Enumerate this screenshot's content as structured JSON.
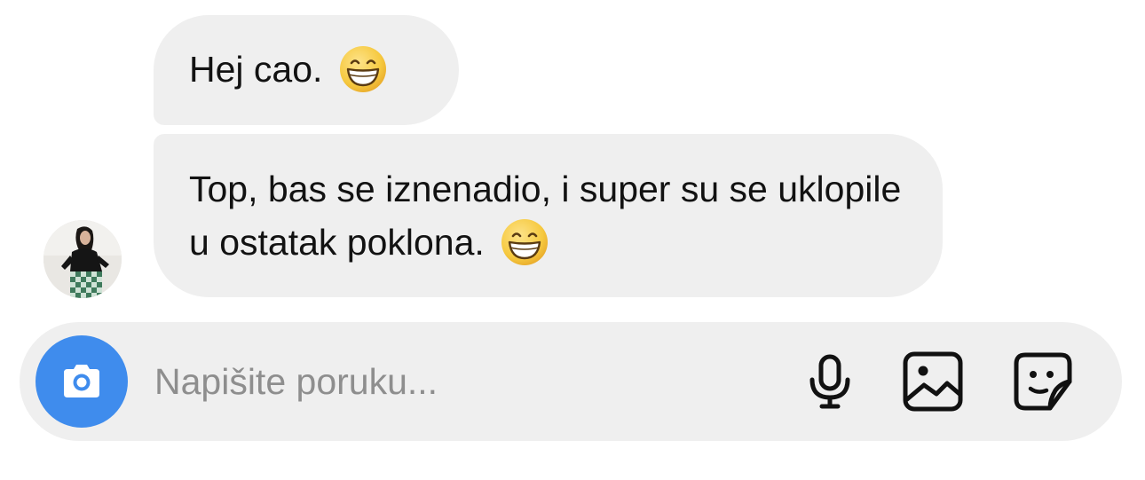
{
  "messages": [
    {
      "text": "Hej cao.",
      "emoji": "grinning-face-with-smiling-eyes"
    },
    {
      "text": "Top, bas se iznenadio, i super su se uklopile u ostatak poklona.",
      "emoji": "grinning-face-with-smiling-eyes"
    }
  ],
  "avatar": {
    "description_icon": "profile-photo"
  },
  "composer": {
    "placeholder": "Napišite poruku...",
    "value": "",
    "camera_icon": "camera-icon",
    "mic_icon": "microphone-icon",
    "gallery_icon": "image-gallery-icon",
    "sticker_icon": "sticker-icon"
  },
  "colors": {
    "bubble_background": "#efefef",
    "composer_background": "#efefef",
    "camera_button": "#3f8ced",
    "placeholder_text": "#8e8e8e",
    "emoji_face": "#f9d24b"
  }
}
